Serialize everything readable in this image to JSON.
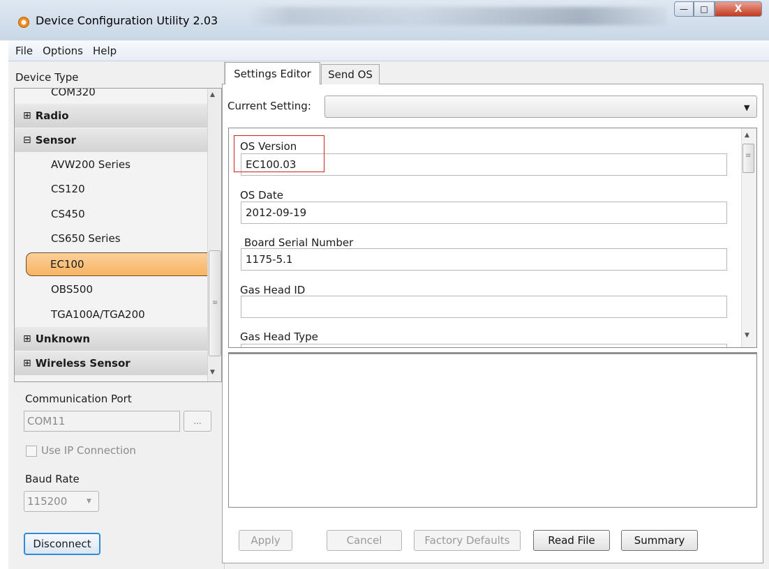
{
  "window": {
    "title": "Device Configuration Utility 2.03",
    "controls": {
      "minimize": "—",
      "maximize": "□",
      "close": "X"
    }
  },
  "menu": {
    "file": "File",
    "options": "Options",
    "help": "Help"
  },
  "left": {
    "device_type_label": "Device Type",
    "tree": {
      "partial_item": "COM320",
      "radio": {
        "sign": "⊞",
        "label": "Radio"
      },
      "sensor": {
        "sign": "⊟",
        "label": "Sensor"
      },
      "sensor_items": [
        "AVW200 Series",
        "CS120",
        "CS450",
        "CS650 Series",
        "EC100",
        "OBS500",
        "TGA100A/TGA200"
      ],
      "selected_item": "EC100",
      "unknown": {
        "sign": "⊞",
        "label": "Unknown"
      },
      "wireless": {
        "sign": "⊞",
        "label": "Wireless Sensor"
      }
    },
    "communication_port_label": "Communication Port",
    "communication_port_value": "COM11",
    "browse_label": "...",
    "use_ip_label": "Use IP Connection",
    "baud_rate_label": "Baud Rate",
    "baud_rate_value": "115200",
    "disconnect_label": "Disconnect"
  },
  "tabs": {
    "settings_editor": "Settings Editor",
    "send_os": "Send OS",
    "active": "Settings Editor"
  },
  "settings_editor": {
    "current_setting_label": "Current Setting:",
    "current_setting_value": "",
    "fields": [
      {
        "label": "OS Version",
        "value": "EC100.03"
      },
      {
        "label": "OS Date",
        "value": "2012-09-19"
      },
      {
        "label": "Board Serial Number",
        "value": "1175-5.1"
      },
      {
        "label": "Gas Head ID",
        "value": ""
      },
      {
        "label": "Gas Head Type",
        "value": ""
      }
    ]
  },
  "buttons": {
    "apply": "Apply",
    "cancel": "Cancel",
    "factory_defaults": "Factory Defaults",
    "read_file": "Read File",
    "summary": "Summary"
  },
  "colors": {
    "selected_item": "#f7b562",
    "highlight_box": "#d02020",
    "focus_border": "#2f8ad8"
  },
  "icons": {
    "app": "circle-app-icon",
    "expand": "plus-box-icon",
    "collapse": "minus-box-icon",
    "dropdown": "chevron-down-icon"
  }
}
